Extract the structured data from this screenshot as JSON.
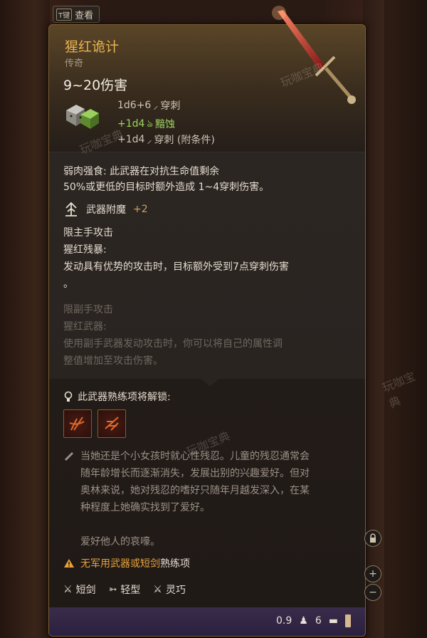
{
  "tab": {
    "key": "T键",
    "label": "查看"
  },
  "item": {
    "name": "猩红诡计",
    "rarity": "传奇",
    "damage": "9~20伤害",
    "damage_lines": [
      {
        "value": "1d6+6",
        "type": "穿刺"
      },
      {
        "value": "+1d4",
        "type": "黯蚀"
      },
      {
        "value": "+1d4",
        "type": "穿刺 (附条件)"
      }
    ]
  },
  "passive": {
    "line1": "弱肉强食: 此武器在对抗生命值剩余",
    "line2": "50%或更低的目标时额外造成 1~4穿刺伤害。"
  },
  "enchant": {
    "label": "武器附魔",
    "value": "+2"
  },
  "main_hand": {
    "restriction": "限主手攻击",
    "ability_name": "猩红残暴:",
    "desc_line1": "发动具有优势的攻击时，目标额外受到7点穿刺伤害",
    "desc_line2": "。"
  },
  "off_hand": {
    "restriction": "限副手攻击",
    "ability_name": "猩红武器:",
    "desc_line1": "使用副手武器发动攻击时，你可以将自己的属性调",
    "desc_line2": "整值增加至攻击伤害。"
  },
  "mastery": {
    "heading": "此武器熟练项将解锁:"
  },
  "lore": {
    "lines": [
      "当她还是个小女孩时就心性残忍。儿童的残忍通常会",
      "随年龄增长而逐渐消失，发展出别的兴趣爱好。但对",
      "奥林来说，她对残忍的嗜好只随年月越发深入，在某",
      "种程度上她确实找到了爱好。"
    ],
    "quote": "爱好他人的哀嚎。"
  },
  "warning": {
    "orange": "无军用武器或短剑",
    "white": "熟练项"
  },
  "properties": [
    "短剑",
    "轻型",
    "灵巧"
  ],
  "footer": {
    "weight": "0.9",
    "price": "6"
  },
  "watermark": "玩咖宝典",
  "colors": {
    "title": "#e9b350",
    "rider_green": "#9fd462",
    "warning": "#e8a23a",
    "footer": "#3a2b4a"
  },
  "icons": [
    "dice-icon",
    "dagger-icon",
    "necrotic-icon",
    "enchant-icon",
    "mastery-lightbulb-icon",
    "quill-icon",
    "warning-icon",
    "weight-icon",
    "gold-icon"
  ]
}
